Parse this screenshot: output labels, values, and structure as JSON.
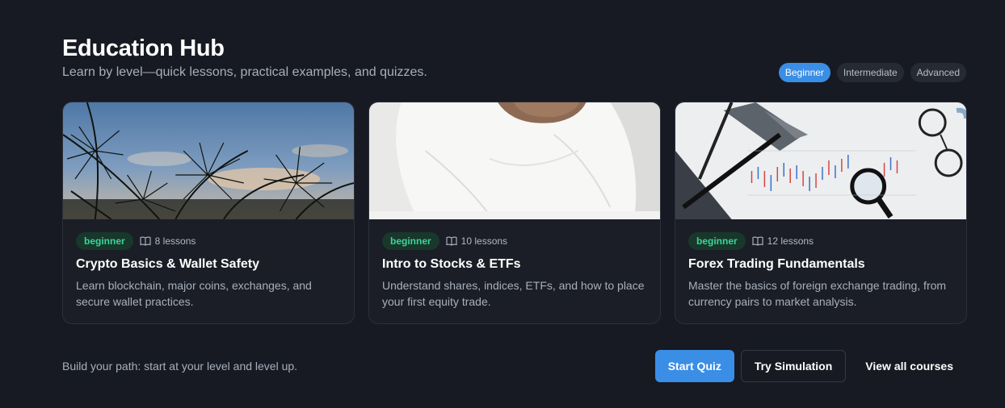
{
  "header": {
    "title": "Education Hub",
    "subtitle": "Learn by level—quick lessons, practical examples, and quizzes."
  },
  "levels": {
    "selected": "Beginner",
    "items": [
      "Beginner",
      "Intermediate",
      "Advanced"
    ]
  },
  "cards": [
    {
      "image": "pine-branches-sky-photo",
      "badge": "beginner",
      "lessons": "8 lessons",
      "title": "Crypto Basics & Wallet Safety",
      "description": "Learn blockchain, major coins, exchanges, and secure wallet practices."
    },
    {
      "image": "person-white-sweater-photo",
      "badge": "beginner",
      "lessons": "10 lessons",
      "title": "Intro to Stocks & ETFs",
      "description": "Understand shares, indices, ETFs, and how to place your first equity trade."
    },
    {
      "image": "forex-chart-magnifier-glasses-photo",
      "badge": "beginner",
      "lessons": "12 lessons",
      "title": "Forex Trading Fundamentals",
      "description": "Master the basics of foreign exchange trading, from currency pairs to market analysis."
    }
  ],
  "footer": {
    "text": "Build your path: start at your level and level up.",
    "start_quiz": "Start Quiz",
    "try_simulation": "Try Simulation",
    "view_all": "View all courses"
  },
  "colors": {
    "background": "#171a22",
    "accent": "#3a8ee6",
    "badge_text": "#3ed39a",
    "badge_bg": "#17382b"
  }
}
